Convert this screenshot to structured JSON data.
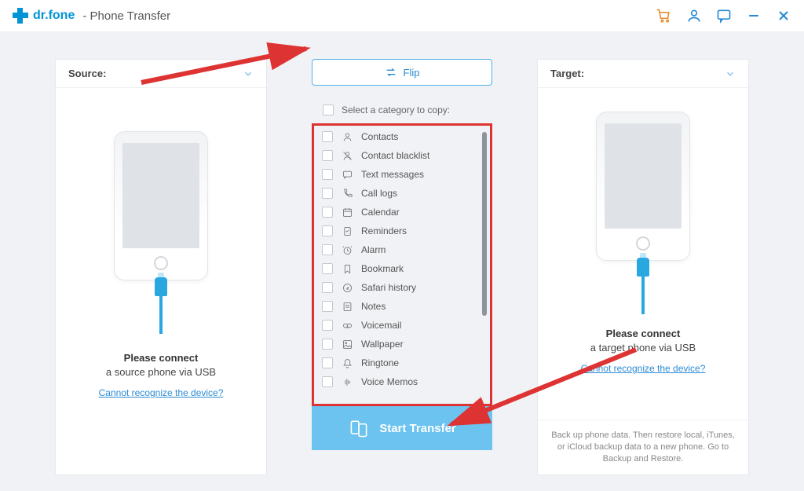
{
  "titlebar": {
    "brand": "dr.fone",
    "suffix": "- Phone Transfer"
  },
  "source_panel": {
    "header": "Source:",
    "msg_bold": "Please connect",
    "msg": "a source phone via USB",
    "help": "Cannot recognize the device?"
  },
  "target_panel": {
    "header": "Target:",
    "msg_bold": "Please connect",
    "msg": "a target phone via USB",
    "help": "Cannot recognize the device?",
    "footnote": "Back up phone data. Then restore local, iTunes, or iCloud backup data to a new phone. Go to Backup and Restore."
  },
  "center": {
    "flip": "Flip",
    "select_all": "Select a category to copy:",
    "start": "Start Transfer",
    "categories": [
      "Contacts",
      "Contact blacklist",
      "Text messages",
      "Call logs",
      "Calendar",
      "Reminders",
      "Alarm",
      "Bookmark",
      "Safari history",
      "Notes",
      "Voicemail",
      "Wallpaper",
      "Ringtone",
      "Voice Memos"
    ]
  }
}
